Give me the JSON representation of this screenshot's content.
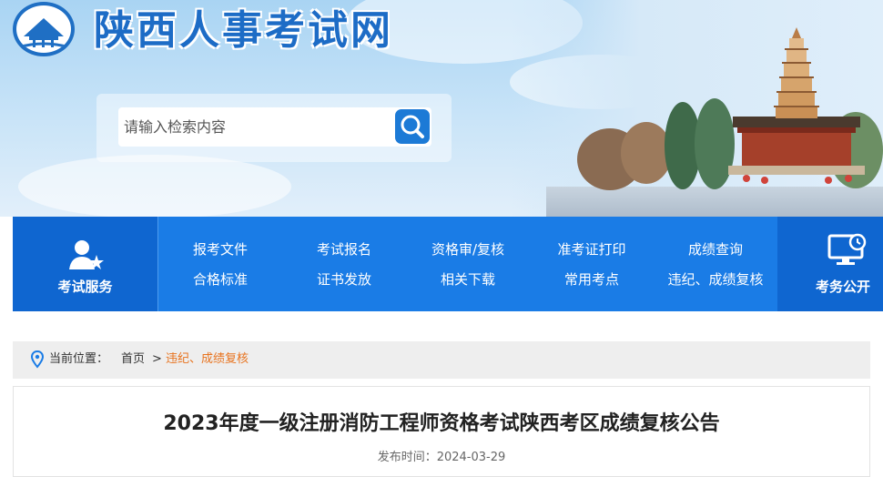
{
  "site": {
    "title": "陕西人事考试网"
  },
  "search": {
    "placeholder": "请输入检索内容"
  },
  "nav": {
    "left_label": "考试服务",
    "right_label": "考务公开",
    "items": [
      {
        "label": "报考文件"
      },
      {
        "label": "考试报名"
      },
      {
        "label": "资格审/复核"
      },
      {
        "label": "准考证打印"
      },
      {
        "label": "成绩查询"
      },
      {
        "label": "合格标准"
      },
      {
        "label": "证书发放"
      },
      {
        "label": "相关下载"
      },
      {
        "label": "常用考点"
      },
      {
        "label": "违纪、成绩复核"
      }
    ]
  },
  "breadcrumb": {
    "prefix": "当前位置：",
    "home": "首页",
    "separator": ">",
    "current": "违纪、成绩复核"
  },
  "article": {
    "title": "2023年度一级注册消防工程师资格考试陕西考区成绩复核公告",
    "date_label": "发布时间：",
    "date": "2024-03-29"
  },
  "colors": {
    "nav_blue": "#1a7ce6",
    "nav_dark": "#0f66d0",
    "title_blue": "#1d6cc6",
    "crumb_active": "#e8731e"
  },
  "icons": [
    "site-emblem-icon",
    "search-icon",
    "user-service-icon",
    "monitor-clock-icon",
    "location-pin-icon"
  ]
}
